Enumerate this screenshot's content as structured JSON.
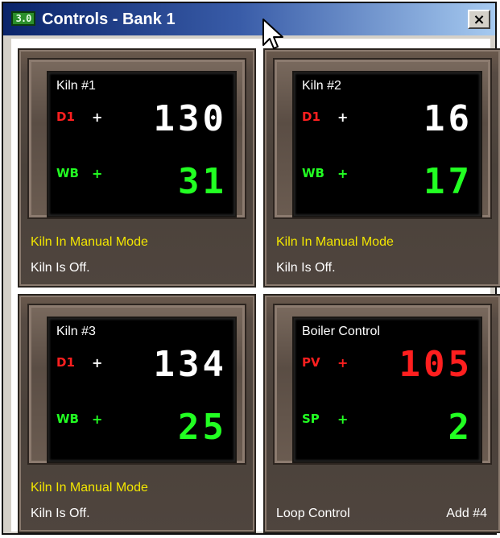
{
  "window": {
    "badge": "3.0",
    "title": "Controls - Bank 1",
    "close_label": "×",
    "close_icon": "close-icon"
  },
  "tiles": [
    {
      "title": "Kiln #1",
      "rows": [
        {
          "label": "D1",
          "plus": "+",
          "value": "130",
          "label_color": "#ff1f1f",
          "plus_color": "#ffffff",
          "value_color": "#ffffff"
        },
        {
          "label": "WB",
          "plus": "+",
          "value": "31",
          "label_color": "#22ff22",
          "plus_color": "#22ff22",
          "value_color": "#22ff22"
        }
      ],
      "status_1": "Kiln In Manual Mode",
      "status_2": "Kiln Is Off."
    },
    {
      "title": "Kiln #2",
      "rows": [
        {
          "label": "D1",
          "plus": "+",
          "value": "16",
          "label_color": "#ff1f1f",
          "plus_color": "#ffffff",
          "value_color": "#ffffff"
        },
        {
          "label": "WB",
          "plus": "+",
          "value": "17",
          "label_color": "#22ff22",
          "plus_color": "#22ff22",
          "value_color": "#22ff22"
        }
      ],
      "status_1": "Kiln In Manual Mode",
      "status_2": "Kiln Is Off."
    },
    {
      "title": "Kiln #3",
      "rows": [
        {
          "label": "D1",
          "plus": "+",
          "value": "134",
          "label_color": "#ff1f1f",
          "plus_color": "#ffffff",
          "value_color": "#ffffff"
        },
        {
          "label": "WB",
          "plus": "+",
          "value": "25",
          "label_color": "#22ff22",
          "plus_color": "#22ff22",
          "value_color": "#22ff22"
        }
      ],
      "status_1": "Kiln In Manual Mode",
      "status_2": "Kiln Is Off."
    },
    {
      "title": "Boiler Control",
      "rows": [
        {
          "label": "PV",
          "plus": "+",
          "value": "105",
          "label_color": "#ff1f1f",
          "plus_color": "#ff1f1f",
          "value_color": "#ff1f1f"
        },
        {
          "label": "SP",
          "plus": "+",
          "value": "2",
          "label_color": "#22ff22",
          "plus_color": "#22ff22",
          "value_color": "#22ff22"
        }
      ],
      "footer_left": "Loop Control",
      "footer_right": "Add #4"
    }
  ]
}
